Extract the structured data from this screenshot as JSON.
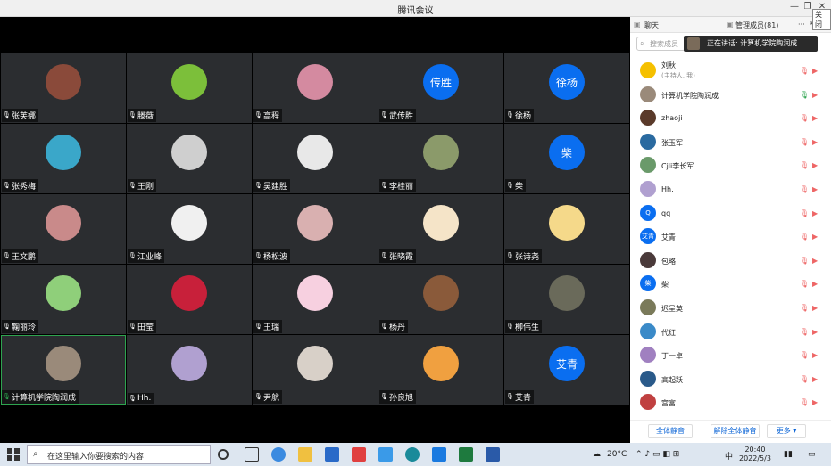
{
  "window": {
    "title": "腾讯会议",
    "tooltip": "关闭"
  },
  "tiles": [
    {
      "name": "张芙娜",
      "av": "#8a4a3a",
      "mic": "muted"
    },
    {
      "name": "滕薇",
      "av": "#7cbf3a",
      "mic": "muted"
    },
    {
      "name": "高程",
      "av": "#d48aa0",
      "mic": "muted"
    },
    {
      "name": "武传胜",
      "av": "#0a6ef0",
      "initials": "传胜",
      "mic": "muted"
    },
    {
      "name": "徐杨",
      "av": "#0a6ef0",
      "initials": "徐杨",
      "mic": "muted"
    },
    {
      "name": "张秀梅",
      "av": "#3aa7c9",
      "mic": "muted"
    },
    {
      "name": "王刚",
      "av": "#cfcfcf",
      "mic": "muted"
    },
    {
      "name": "吴建胜",
      "av": "#e8e8e8",
      "mic": "muted"
    },
    {
      "name": "李桂丽",
      "av": "#8b9a6a",
      "mic": "muted"
    },
    {
      "name": "柴",
      "av": "#0a6ef0",
      "initials": "柴",
      "mic": "muted"
    },
    {
      "name": "王文鹏",
      "av": "#c98a8a",
      "mic": "muted"
    },
    {
      "name": "江业峰",
      "av": "#f0f0f0",
      "mic": "muted"
    },
    {
      "name": "杨松波",
      "av": "#d9b0b0",
      "mic": "muted"
    },
    {
      "name": "张晓霞",
      "av": "#f5e4c8",
      "mic": "muted"
    },
    {
      "name": "张诗尧",
      "av": "#f5d98a",
      "mic": "muted"
    },
    {
      "name": "鞠丽玲",
      "av": "#8fcf7a",
      "mic": "muted"
    },
    {
      "name": "田莹",
      "av": "#c8203a",
      "mic": "muted"
    },
    {
      "name": "王瑞",
      "av": "#f7d0e0",
      "mic": "muted"
    },
    {
      "name": "杨丹",
      "av": "#8a5a3a",
      "mic": "muted"
    },
    {
      "name": "柳伟生",
      "av": "#6a6a5a",
      "mic": "muted"
    },
    {
      "name": "计算机学院陶润成",
      "av": "#9a8a7a",
      "mic": "active"
    },
    {
      "name": "Hh.",
      "av": "#b0a0d0",
      "mic": "muted"
    },
    {
      "name": "尹航",
      "av": "#d8d0c8",
      "mic": "muted"
    },
    {
      "name": "孙良旭",
      "av": "#f0a040",
      "mic": "muted"
    },
    {
      "name": "艾青",
      "av": "#0a6ef0",
      "initials": "艾青",
      "mic": "muted"
    }
  ],
  "panel": {
    "tab_chat": "聊天",
    "tab_members": "管理成员(81)",
    "search_placeholder": "搜索成员",
    "speaking": "正在讲话: 计算机学院陶润成",
    "members": [
      {
        "name": "刘秋",
        "sub": "(主持人, 我)",
        "av": "#f5c000",
        "mic": "muted"
      },
      {
        "name": "计算机学院陶润成",
        "av": "#9a8a7a",
        "mic": "on"
      },
      {
        "name": "zhaoji",
        "av": "#5a3a2a",
        "mic": "muted"
      },
      {
        "name": "张玉军",
        "av": "#2a6aa0",
        "mic": "muted"
      },
      {
        "name": "Cjli李长军",
        "av": "#6a9a6a",
        "mic": "muted"
      },
      {
        "name": "Hh.",
        "av": "#b0a0d0",
        "mic": "muted"
      },
      {
        "name": "qq",
        "av": "#0a6ef0",
        "initials": "Q",
        "mic": "muted"
      },
      {
        "name": "艾青",
        "av": "#0a6ef0",
        "initials": "艾青",
        "mic": "muted"
      },
      {
        "name": "包略",
        "av": "#4a3a3a",
        "mic": "muted"
      },
      {
        "name": "柴",
        "av": "#0a6ef0",
        "initials": "柴",
        "mic": "muted"
      },
      {
        "name": "迟呈英",
        "av": "#7a7a5a",
        "mic": "muted"
      },
      {
        "name": "代红",
        "av": "#3a8ac8",
        "mic": "muted"
      },
      {
        "name": "丁一卓",
        "av": "#a080c0",
        "mic": "muted"
      },
      {
        "name": "高起跃",
        "av": "#2a5a8a",
        "mic": "muted"
      },
      {
        "name": "宫富",
        "av": "#c04040",
        "mic": "muted"
      }
    ],
    "btn_mute_all": "全体静音",
    "btn_unmute_all": "解除全体静音",
    "btn_more": "更多"
  },
  "taskbar": {
    "search_placeholder": "在这里输入你要搜索的内容",
    "weather": "20°C",
    "ime": "中",
    "time": "20:40",
    "date": "2022/5/3"
  }
}
